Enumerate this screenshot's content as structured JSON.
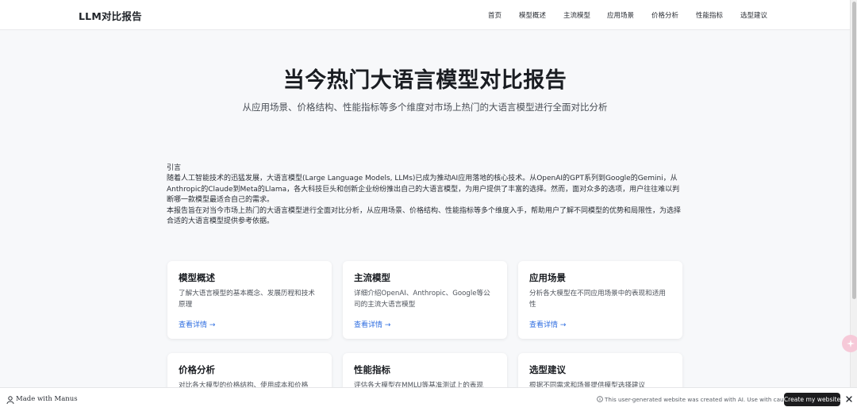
{
  "header": {
    "brand": "LLM对比报告",
    "nav": [
      {
        "label": "首页"
      },
      {
        "label": "模型概述"
      },
      {
        "label": "主流模型"
      },
      {
        "label": "应用场景"
      },
      {
        "label": "价格分析"
      },
      {
        "label": "性能指标"
      },
      {
        "label": "选型建议"
      }
    ]
  },
  "hero": {
    "title": "当今热门大语言模型对比报告",
    "subtitle": "从应用场景、价格结构、性能指标等多个维度对市场上热门的大语言模型进行全面对比分析"
  },
  "intro": {
    "heading": "引言",
    "p1": "随着人工智能技术的迅猛发展，大语言模型(Large Language Models, LLMs)已成为推动AI应用落地的核心技术。从OpenAI的GPT系列到Google的Gemini，从Anthropic的Claude到Meta的Llama，各大科技巨头和创新企业纷纷推出自己的大语言模型，为用户提供了丰富的选择。然而，面对众多的选项，用户往往难以判断哪一款模型最适合自己的需求。",
    "p2": "本报告旨在对当今市场上热门的大语言模型进行全面对比分析，从应用场景、价格结构、性能指标等多个维度入手，帮助用户了解不同模型的优势和局限性，为选择合适的大语言模型提供参考依据。"
  },
  "cards": [
    {
      "title": "模型概述",
      "desc": "了解大语言模型的基本概念、发展历程和技术原理",
      "link": "查看详情 →"
    },
    {
      "title": "主流模型",
      "desc": "详细介绍OpenAI、Anthropic、Google等公司的主流大语言模型",
      "link": "查看详情 →"
    },
    {
      "title": "应用场景",
      "desc": "分析各大模型在不同应用场景中的表现和适用性",
      "link": "查看详情 →"
    },
    {
      "title": "价格分析",
      "desc": "对比各大模型的价格结构、使用成本和价格"
    },
    {
      "title": "性能指标",
      "desc": "评估各大模型在MMLU等基准测试上的表现"
    },
    {
      "title": "选型建议",
      "desc": "根据不同需求和场景提供模型选择建议"
    }
  ],
  "footer": {
    "made_with": "Made with Manus",
    "notice": "This user-generated website was created with AI. Use with caution.",
    "create_button": "Create my website"
  }
}
